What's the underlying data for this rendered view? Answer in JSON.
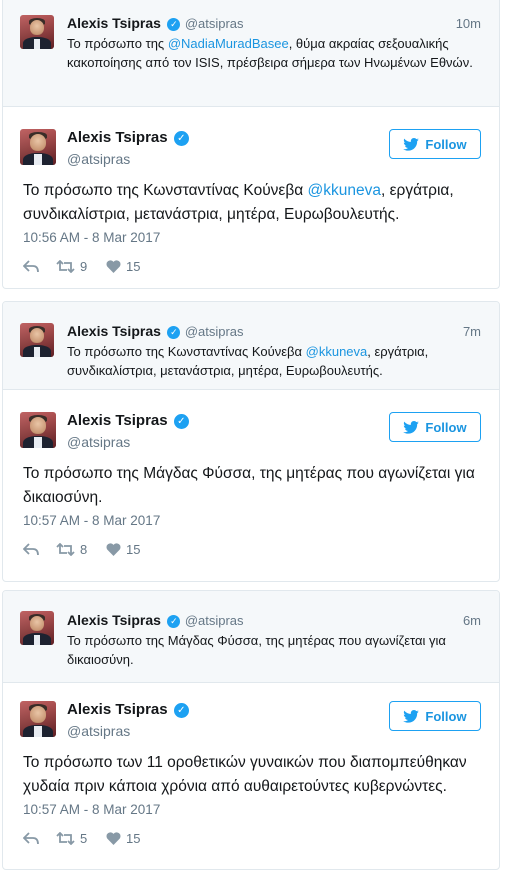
{
  "colors": {
    "link": "#1b95e0",
    "follow_border": "#1da1f2",
    "verified": "#1da1f2",
    "muted": "#657786"
  },
  "tweets": [
    {
      "context": {
        "name": "Alexis Tsipras",
        "handle": "@atsipras",
        "time": "10m",
        "text_before": "Το πρόσωπο της ",
        "mention": "@NadiaMuradBasee",
        "text_after": ", θύμα ακραίας σεξουαλικής κακοποίησης από τον ISIS, πρέσβειρα σήμερα των Ηνωμένων Εθνών."
      },
      "main": {
        "name": "Alexis Tsipras",
        "handle": "@atsipras",
        "follow_label": "Follow",
        "text_before": "Το πρόσωπο της Κωνσταντίνας Κούνεβα ",
        "mention": "@kkuneva",
        "text_after": ", εργάτρια, συνδικαλίστρια, μετανάστρια, μητέρα, Ευρωβουλευτής.",
        "timestamp": "10:56 AM - 8 Mar 2017",
        "retweets": "9",
        "likes": "15"
      }
    },
    {
      "context": {
        "name": "Alexis Tsipras",
        "handle": "@atsipras",
        "time": "7m",
        "text_before": "Το πρόσωπο της Κωνσταντίνας Κούνεβα ",
        "mention": "@kkuneva",
        "text_after": ", εργάτρια, συνδικαλίστρια, μετανάστρια, μητέρα, Ευρωβουλευτής."
      },
      "main": {
        "name": "Alexis Tsipras",
        "handle": "@atsipras",
        "follow_label": "Follow",
        "text_before": "Το πρόσωπο της Μάγδας Φύσσα, της μητέρας που αγωνίζεται για δικαιοσύνη.",
        "mention": "",
        "text_after": "",
        "timestamp": "10:57 AM - 8 Mar 2017",
        "retweets": "8",
        "likes": "15"
      }
    },
    {
      "context": {
        "name": "Alexis Tsipras",
        "handle": "@atsipras",
        "time": "6m",
        "text_before": "Το πρόσωπο της Μάγδας Φύσσα, της μητέρας που αγωνίζεται για δικαιοσύνη.",
        "mention": "",
        "text_after": ""
      },
      "main": {
        "name": "Alexis Tsipras",
        "handle": "@atsipras",
        "follow_label": "Follow",
        "text_before": "Το πρόσωπο των 11 οροθετικών γυναικών που διαπομπεύθηκαν χυδαία πριν κάποια χρόνια από αυθαιρετούντες κυβερνώντες.",
        "mention": "",
        "text_after": "",
        "timestamp": "10:57 AM - 8 Mar 2017",
        "retweets": "5",
        "likes": "15"
      }
    }
  ]
}
